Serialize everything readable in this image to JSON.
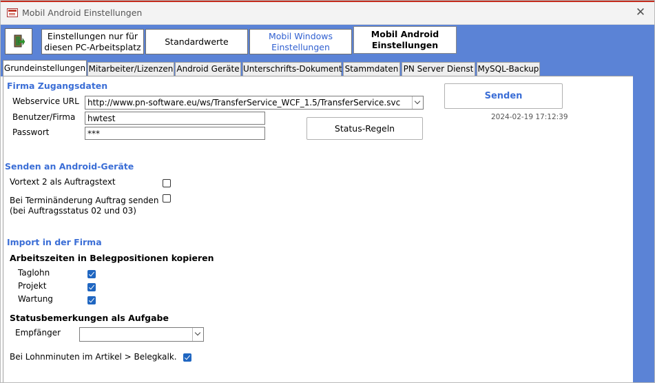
{
  "window": {
    "title": "Mobil Android Einstellungen"
  },
  "toolbar": {
    "buttons": [
      {
        "label_line1": "Einstellungen nur für",
        "label_line2": "diesen PC-Arbeitsplatz"
      },
      {
        "label_line1": "Standardwerte",
        "label_line2": ""
      },
      {
        "label_line1": "Mobil Windows",
        "label_line2": "Einstellungen"
      },
      {
        "label_line1": "Mobil Android",
        "label_line2": "Einstellungen"
      }
    ]
  },
  "tabs": [
    "Grundeinstellungen",
    "Mitarbeiter/Lizenzen",
    "Android Geräte",
    "Unterschrifts-Dokument",
    "Stammdaten",
    "PN Server Dienst",
    "MySQL-Backup"
  ],
  "firma": {
    "heading": "Firma Zugangsdaten",
    "url_label": "Webservice URL",
    "url_value": "http://www.pn-software.eu/ws/TransferService_WCF_1.5/TransferService.svc",
    "user_label": "Benutzer/Firma",
    "user_value": "hwtest",
    "pass_label": "Passwort",
    "pass_value": "***"
  },
  "actions": {
    "send_label": "Senden",
    "timestamp": "2024-02-19 17:12:39",
    "status_label": "Status-Regeln"
  },
  "android": {
    "heading": "Senden an Android-Geräte",
    "vortext_label": "Vortext 2 als Auftragstext",
    "vortext_checked": false,
    "termin_label_line1": "Bei Terminänderung Auftrag senden",
    "termin_label_line2": "(bei Auftragsstatus 02 und 03)",
    "termin_checked": false
  },
  "import": {
    "heading": "Import in der Firma",
    "arbeitszeiten_heading": "Arbeitszeiten in Belegpositionen kopieren",
    "taglohn_label": "Taglohn",
    "taglohn_checked": true,
    "projekt_label": "Projekt",
    "projekt_checked": true,
    "wartung_label": "Wartung",
    "wartung_checked": true,
    "status_heading": "Statusbemerkungen als Aufgabe",
    "empfaenger_label": "Empfänger",
    "empfaenger_value": "",
    "lohn_label": "Bei Lohnminuten im Artikel > Belegkalk.",
    "lohn_checked": true
  },
  "colors": {
    "band": "#5b83d6",
    "accent": "#3b6ed6",
    "checkbox": "#1f66c1"
  }
}
